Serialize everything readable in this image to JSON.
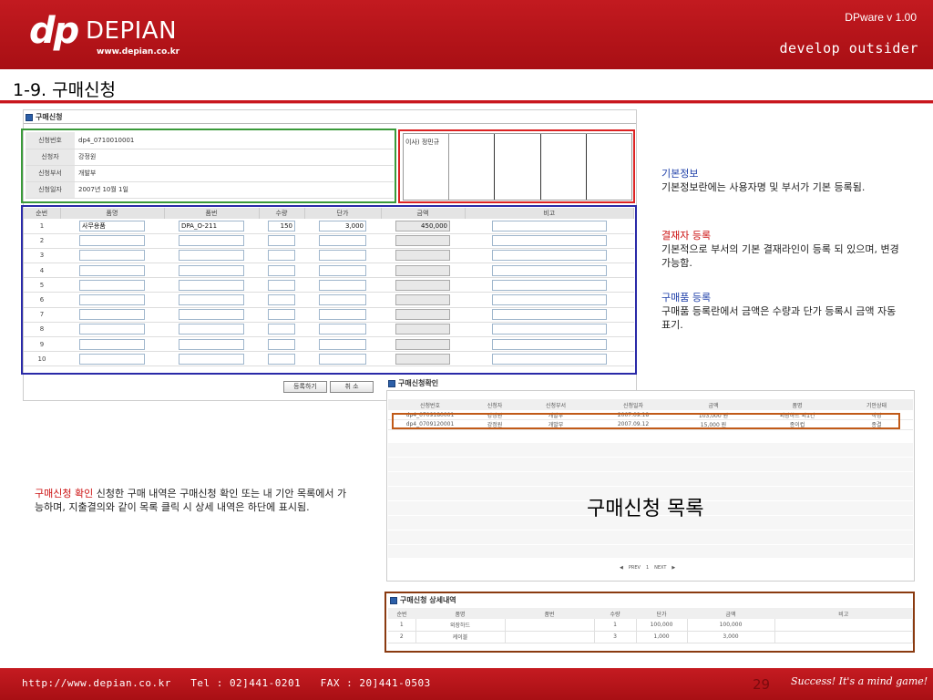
{
  "header": {
    "logo_dp": "dp",
    "logo_name": "DEPIAN",
    "logo_url": "www.depian.co.kr",
    "version": "DPware v 1.00",
    "slogan": "develop outsider"
  },
  "page_title": "1-9. 구매신청",
  "form": {
    "section_title": "구매신청",
    "info": [
      {
        "label": "신청번호",
        "value": "dp4_0710010001"
      },
      {
        "label": "신청자",
        "value": "강정원"
      },
      {
        "label": "신청부서",
        "value": "개발부"
      },
      {
        "label": "신청일자",
        "value": "2007년 10월 1일"
      }
    ],
    "approver": "이사) 정민규",
    "columns": [
      "순번",
      "품명",
      "품번",
      "수량",
      "단가",
      "금액",
      "비고"
    ],
    "rows": [
      {
        "no": "1",
        "name": "사무용품",
        "code": "DPA_O-211",
        "qty": "150",
        "price": "3,000",
        "amount": "450,000",
        "note": ""
      },
      {
        "no": "2",
        "name": "",
        "code": "",
        "qty": "",
        "price": "",
        "amount": "",
        "note": ""
      },
      {
        "no": "3",
        "name": "",
        "code": "",
        "qty": "",
        "price": "",
        "amount": "",
        "note": ""
      },
      {
        "no": "4",
        "name": "",
        "code": "",
        "qty": "",
        "price": "",
        "amount": "",
        "note": ""
      },
      {
        "no": "5",
        "name": "",
        "code": "",
        "qty": "",
        "price": "",
        "amount": "",
        "note": ""
      },
      {
        "no": "6",
        "name": "",
        "code": "",
        "qty": "",
        "price": "",
        "amount": "",
        "note": ""
      },
      {
        "no": "7",
        "name": "",
        "code": "",
        "qty": "",
        "price": "",
        "amount": "",
        "note": ""
      },
      {
        "no": "8",
        "name": "",
        "code": "",
        "qty": "",
        "price": "",
        "amount": "",
        "note": ""
      },
      {
        "no": "9",
        "name": "",
        "code": "",
        "qty": "",
        "price": "",
        "amount": "",
        "note": ""
      },
      {
        "no": "10",
        "name": "",
        "code": "",
        "qty": "",
        "price": "",
        "amount": "",
        "note": ""
      }
    ],
    "register_label": "등록하기",
    "cancel_label": "취 소"
  },
  "notes": {
    "basic_title": "기본정보",
    "basic_text": "기본정보란에는 사용자명 및 부서가 기본 등록됨.",
    "approver_title": "결재자 등록",
    "approver_text": "기본적으로 부서의 기본 결재라인이 등록 되 있으며, 변경 가능함.",
    "item_title": "구매품 등록",
    "item_text": "구매품 등록란에서 금액은 수량과 단가 등록시 금액 자동 표기.",
    "confirm_title": "구매신청 확인",
    "confirm_text": "신청한 구매 내역은 구매신청 확인 또는 내 기안 목록에서 가능하며, 지출결의와 같이 목록 클릭 시 상세 내역은 하단에 표시됨."
  },
  "list": {
    "section_title": "구매신청확인",
    "columns": [
      "신청번호",
      "신청자",
      "신청부서",
      "신청일자",
      "금액",
      "품명",
      "기안상태"
    ],
    "rows": [
      {
        "no": "dp4_0709180001",
        "user": "강정원",
        "dept": "개발부",
        "date": "2007.09.18",
        "amount": "103,000 원",
        "name": "외장하드 외1건",
        "status": "작성"
      },
      {
        "no": "dp4_0709120001",
        "user": "강정원",
        "dept": "개발부",
        "date": "2007.09.12",
        "amount": "15,000 원",
        "name": "종이컵",
        "status": "종결"
      }
    ],
    "caption": "구매신청 목록",
    "pager_prev": "PREV",
    "pager_page": "1",
    "pager_next": "NEXT"
  },
  "detail": {
    "section_title": "구매신청 상세내역",
    "columns": [
      "순번",
      "품명",
      "품번",
      "수량",
      "단가",
      "금액",
      "비고"
    ],
    "rows": [
      {
        "no": "1",
        "name": "외장하드",
        "code": "",
        "qty": "1",
        "price": "100,000",
        "amount": "100,000",
        "note": ""
      },
      {
        "no": "2",
        "name": "케이블",
        "code": "",
        "qty": "3",
        "price": "1,000",
        "amount": "3,000",
        "note": ""
      }
    ]
  },
  "footer": {
    "url": "http://www.depian.co.kr",
    "tel": "Tel : 02]441-0201",
    "fax": "FAX : 20]441-0503",
    "page": "29",
    "signature": "Success! It's a mind game!"
  },
  "colors": {
    "brand_red": "#c0171d",
    "green_box": "#3a9a3a",
    "red_box": "#dd2222",
    "blue_box": "#2a2aa8",
    "orange_box": "#c15a18"
  }
}
